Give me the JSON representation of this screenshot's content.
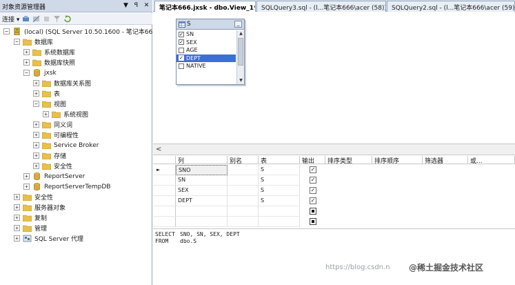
{
  "object_explorer": {
    "title": "对象资源管理器",
    "title_buttons": [
      "▼",
      "ꟼ",
      "✕"
    ],
    "toolbar": {
      "connect_label": "连接 ▾"
    },
    "tree": [
      {
        "label": "(local) (SQL Server 10.50.1600 - 笔记本666\\",
        "exp": "−",
        "icon": "server"
      },
      {
        "label": "数据库",
        "exp": "−",
        "icon": "folder"
      },
      {
        "label": "系统数据库",
        "exp": "+",
        "icon": "folder"
      },
      {
        "label": "数据库快照",
        "exp": "+",
        "icon": "folder"
      },
      {
        "label": "jxsk",
        "exp": "−",
        "icon": "database"
      },
      {
        "label": "数据库关系图",
        "exp": "+",
        "icon": "folder"
      },
      {
        "label": "表",
        "exp": "+",
        "icon": "folder"
      },
      {
        "label": "视图",
        "exp": "−",
        "icon": "folder"
      },
      {
        "label": "系统视图",
        "exp": "+",
        "icon": "folder"
      },
      {
        "label": "同义词",
        "exp": "+",
        "icon": "folder"
      },
      {
        "label": "可编程性",
        "exp": "+",
        "icon": "folder"
      },
      {
        "label": "Service Broker",
        "exp": "+",
        "icon": "folder"
      },
      {
        "label": "存储",
        "exp": "+",
        "icon": "folder"
      },
      {
        "label": "安全性",
        "exp": "+",
        "icon": "folder"
      },
      {
        "label": "ReportServer",
        "exp": "+",
        "icon": "database"
      },
      {
        "label": "ReportServerTempDB",
        "exp": "+",
        "icon": "database"
      },
      {
        "label": "安全性",
        "exp": "+",
        "icon": "folder"
      },
      {
        "label": "服务器对象",
        "exp": "+",
        "icon": "folder"
      },
      {
        "label": "复制",
        "exp": "+",
        "icon": "folder"
      },
      {
        "label": "管理",
        "exp": "+",
        "icon": "folder"
      },
      {
        "label": "SQL Server 代理",
        "exp": "+",
        "icon": "agent"
      }
    ]
  },
  "tabs": [
    {
      "label": "笔记本666.jxsk - dbo.View_1*",
      "close": "×",
      "active": true
    },
    {
      "label": "SQLQuery3.sql - (l...笔记本666\\acer (58))*",
      "close": "",
      "active": false
    },
    {
      "label": "SQLQuery2.sql - (l...笔记本666\\acer (59))*",
      "close": "",
      "active": false
    }
  ],
  "diagram": {
    "table_name": "S",
    "min_button": "_",
    "columns": [
      {
        "name": "SN",
        "checked": true,
        "selected": false
      },
      {
        "name": "SEX",
        "checked": true,
        "selected": false
      },
      {
        "name": "AGE",
        "checked": false,
        "selected": false
      },
      {
        "name": "DEPT",
        "checked": true,
        "selected": true
      },
      {
        "name": "NATIVE",
        "checked": false,
        "selected": false
      }
    ],
    "scroll_up": "▲",
    "scroll_down": "▼"
  },
  "grid": {
    "left_arrow": "<",
    "headers": [
      "列",
      "别名",
      "表",
      "输出",
      "排序类型",
      "排序顺序",
      "筛选器",
      "或..."
    ],
    "rows": [
      {
        "marker": "►",
        "column": "SNO",
        "alias": "",
        "table": "S",
        "output": "check"
      },
      {
        "marker": "",
        "column": "SN",
        "alias": "",
        "table": "S",
        "output": "check"
      },
      {
        "marker": "",
        "column": "SEX",
        "alias": "",
        "table": "S",
        "output": "check"
      },
      {
        "marker": "",
        "column": "DEPT",
        "alias": "",
        "table": "S",
        "output": "check"
      },
      {
        "marker": "",
        "column": "",
        "alias": "",
        "table": "",
        "output": "square"
      },
      {
        "marker": "",
        "column": "",
        "alias": "",
        "table": "",
        "output": "square"
      }
    ]
  },
  "sql": {
    "select_kw": "SELECT",
    "select_cols": "SNO, SN, SEX, DEPT",
    "from_kw": "FROM",
    "from_table": "dbo.S"
  },
  "watermark": {
    "url": "https://blog.csdn.n",
    "logo": "@稀土掘金技术社区"
  },
  "colors": {
    "panel_title": "#cfd9e8",
    "selection": "#3a6fd8",
    "folder": "#e8c04a",
    "database": "#d9a93a"
  }
}
